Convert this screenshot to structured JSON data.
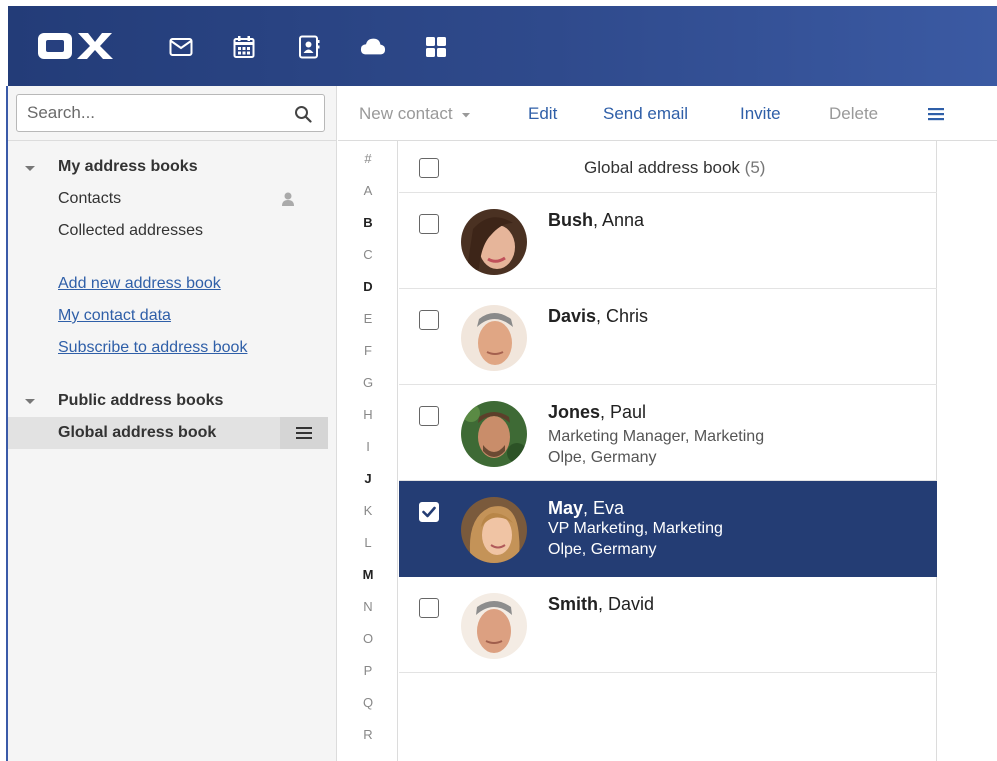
{
  "topbar": {
    "logo": "OX",
    "apps": [
      {
        "icon": "mail-icon"
      },
      {
        "icon": "calendar-icon"
      },
      {
        "icon": "address-book-icon"
      },
      {
        "icon": "cloud-icon"
      },
      {
        "icon": "apps-grid-icon"
      }
    ]
  },
  "sidebar": {
    "search_placeholder": "Search...",
    "my_books": {
      "heading": "My address books",
      "items": [
        "Contacts",
        "Collected addresses"
      ]
    },
    "links": [
      "Add new address book",
      "My contact data",
      "Subscribe to address book"
    ],
    "public_books": {
      "heading": "Public address books",
      "selected_item": "Global address book"
    }
  },
  "toolbar": {
    "new_contact": "New contact",
    "edit": "Edit",
    "send_email": "Send email",
    "invite": "Invite",
    "delete": "Delete"
  },
  "letters": [
    "#",
    "A",
    "B",
    "C",
    "D",
    "E",
    "F",
    "G",
    "H",
    "I",
    "J",
    "K",
    "L",
    "M",
    "N",
    "O",
    "P",
    "Q",
    "R"
  ],
  "bold_letters": [
    "B",
    "D",
    "J",
    "M"
  ],
  "list": {
    "title": "Global address book",
    "count": "(5)",
    "contacts": [
      {
        "last": "Bush",
        "first": ", Anna",
        "line1": "",
        "line2": "",
        "selected": false
      },
      {
        "last": "Davis",
        "first": ", Chris",
        "line1": "",
        "line2": "",
        "selected": false
      },
      {
        "last": "Jones",
        "first": ", Paul",
        "line1": "Marketing Manager, Marketing",
        "line2": "Olpe, Germany",
        "selected": false
      },
      {
        "last": "May",
        "first": ", Eva",
        "line1": "VP Marketing, Marketing",
        "line2": "Olpe, Germany",
        "selected": true
      },
      {
        "last": "Smith",
        "first": ", David",
        "line1": "",
        "line2": "",
        "selected": false
      }
    ]
  },
  "colors": {
    "topbar": "#2f4a8c",
    "selection": "#243d74",
    "link": "#2f5fa8"
  }
}
